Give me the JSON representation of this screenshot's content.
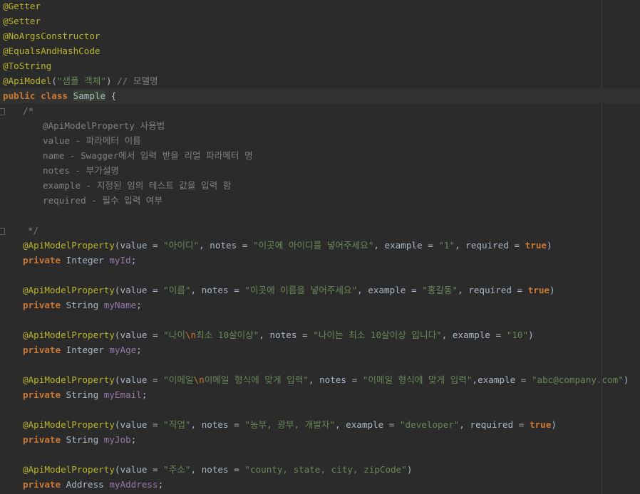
{
  "header_annotations": [
    "@Getter",
    "@Setter",
    "@NoArgsConstructor",
    "@EqualsAndHashCode",
    "@ToString"
  ],
  "api_model": {
    "annotation": "@ApiModel",
    "value": "\"샘플 객체\"",
    "comment": "// 모델명"
  },
  "class_decl": {
    "public_kw": "public",
    "class_kw": "class",
    "name": "Sample",
    "brace": " {"
  },
  "doc_comment": {
    "open": "/*",
    "lines": [
      "@ApiModelProperty 사용법",
      "value - 파라메터 이름",
      "name - Swagger에서 입력 받을 리얼 파라메터 명",
      "notes - 부가설명",
      "example - 지정된 임의 테스트 값을 입력 함",
      "required - 필수 입력 여부"
    ],
    "close": "*/"
  },
  "properties": [
    {
      "annotation": "@ApiModelProperty",
      "args": [
        {
          "key": "value",
          "val": "\"아이디\""
        },
        {
          "key": "notes",
          "val": "\"이곳에 아이디를 넣어주세요\""
        },
        {
          "key": "example",
          "val": "\"1\""
        },
        {
          "key": "required",
          "val": "true",
          "kw": true
        }
      ],
      "modifier": "private",
      "type": "Integer",
      "name": "myId"
    },
    {
      "annotation": "@ApiModelProperty",
      "args": [
        {
          "key": "value",
          "val": "\"이름\""
        },
        {
          "key": "notes",
          "val": "\"이곳에 이름을 넣어주세요\""
        },
        {
          "key": "example",
          "val": "\"홍길동\""
        },
        {
          "key": "required",
          "val": "true",
          "kw": true
        }
      ],
      "modifier": "private",
      "type": "String",
      "name": "myName"
    },
    {
      "annotation": "@ApiModelProperty",
      "args": [
        {
          "key": "value",
          "val_parts": [
            "\"나이",
            "\\n",
            "최소 10살이상\""
          ]
        },
        {
          "key": "notes",
          "val": "\"나이는 최소 10살이상 입니다\""
        },
        {
          "key": "example",
          "val": "\"10\""
        }
      ],
      "modifier": "private",
      "type": "Integer",
      "name": "myAge"
    },
    {
      "annotation": "@ApiModelProperty",
      "args": [
        {
          "key": "value",
          "val_parts": [
            "\"이메일",
            "\\n",
            "이메일 형식에 맞게 입력\""
          ]
        },
        {
          "key": "notes",
          "val": "\"이메일 형식에 맞게 입력\"",
          "nospace_after": true
        },
        {
          "key": "example",
          "val": "\"abc@company.com\""
        }
      ],
      "modifier": "private",
      "type": "String",
      "name": "myEmail"
    },
    {
      "annotation": "@ApiModelProperty",
      "args": [
        {
          "key": "value",
          "val": "\"직업\""
        },
        {
          "key": "notes",
          "val": "\"농부, 광부, 개발자\""
        },
        {
          "key": "example",
          "val": "\"developer\""
        },
        {
          "key": "required",
          "val": "true",
          "kw": true
        }
      ],
      "modifier": "private",
      "type": "String",
      "name": "myJob"
    },
    {
      "annotation": "@ApiModelProperty",
      "args": [
        {
          "key": "value",
          "val": "\"주소\""
        },
        {
          "key": "notes",
          "val": "\"county, state, city, zipCode\""
        }
      ],
      "modifier": "private",
      "type": "Address",
      "name": "myAddress"
    }
  ],
  "colors": {
    "background": "#2b2b2b",
    "annotation": "#bbb529",
    "keyword": "#cc7832",
    "string": "#6a8759",
    "comment": "#808080",
    "field": "#9876aa",
    "text": "#a9b7c6"
  }
}
